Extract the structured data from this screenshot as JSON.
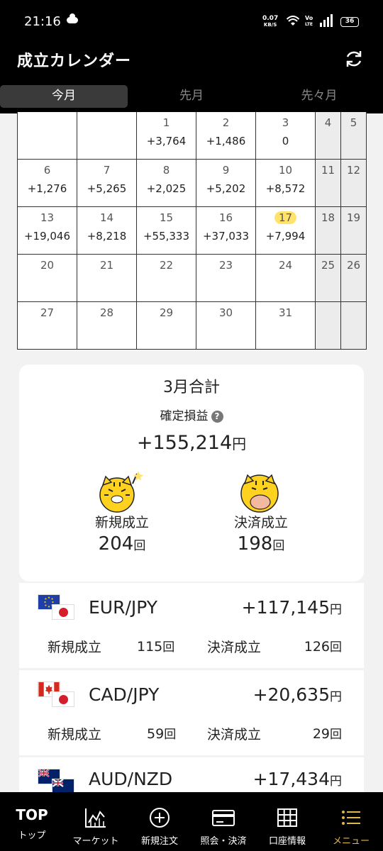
{
  "status_bar": {
    "time": "21:16",
    "net_speed_value": "0.07",
    "net_speed_unit": "KB/S",
    "volte_top": "Vo",
    "volte_bottom": "LTE",
    "battery": "36"
  },
  "header": {
    "title": "成立カレンダー",
    "refresh_icon": "refresh-icon"
  },
  "tabs": [
    {
      "label": "今月",
      "active": true
    },
    {
      "label": "先月",
      "active": false
    },
    {
      "label": "先々月",
      "active": false
    }
  ],
  "calendar": {
    "today": "17",
    "weeks": [
      [
        {
          "day": "",
          "value": ""
        },
        {
          "day": "",
          "value": ""
        },
        {
          "day": "1",
          "value": "+3,764"
        },
        {
          "day": "2",
          "value": "+1,486"
        },
        {
          "day": "3",
          "value": "0"
        },
        {
          "day": "4",
          "value": ""
        },
        {
          "day": "5",
          "value": ""
        }
      ],
      [
        {
          "day": "6",
          "value": "+1,276"
        },
        {
          "day": "7",
          "value": "+5,265"
        },
        {
          "day": "8",
          "value": "+2,025"
        },
        {
          "day": "9",
          "value": "+5,202"
        },
        {
          "day": "10",
          "value": "+8,572"
        },
        {
          "day": "11",
          "value": ""
        },
        {
          "day": "12",
          "value": ""
        }
      ],
      [
        {
          "day": "13",
          "value": "+19,046"
        },
        {
          "day": "14",
          "value": "+8,218"
        },
        {
          "day": "15",
          "value": "+55,333"
        },
        {
          "day": "16",
          "value": "+37,033"
        },
        {
          "day": "17",
          "value": "+7,994"
        },
        {
          "day": "18",
          "value": ""
        },
        {
          "day": "19",
          "value": ""
        }
      ],
      [
        {
          "day": "20",
          "value": ""
        },
        {
          "day": "21",
          "value": ""
        },
        {
          "day": "22",
          "value": ""
        },
        {
          "day": "23",
          "value": ""
        },
        {
          "day": "24",
          "value": ""
        },
        {
          "day": "25",
          "value": ""
        },
        {
          "day": "26",
          "value": ""
        }
      ],
      [
        {
          "day": "27",
          "value": ""
        },
        {
          "day": "28",
          "value": ""
        },
        {
          "day": "29",
          "value": ""
        },
        {
          "day": "30",
          "value": ""
        },
        {
          "day": "31",
          "value": ""
        },
        {
          "day": "",
          "value": ""
        },
        {
          "day": "",
          "value": ""
        }
      ]
    ]
  },
  "summary": {
    "title": "3月合計",
    "label": "確定損益",
    "help_glyph": "?",
    "amount": "+155,214",
    "amount_unit": "円",
    "new_label": "新規成立",
    "new_count": "204",
    "settle_label": "決済成立",
    "settle_count": "198",
    "count_unit": "回"
  },
  "pairs": [
    {
      "name": "EUR/JPY",
      "amount": "+117,145",
      "new_label": "新規成立",
      "new_count": "115",
      "settle_label": "決済成立",
      "settle_count": "126",
      "flag": "eu"
    },
    {
      "name": "CAD/JPY",
      "amount": "+20,635",
      "new_label": "新規成立",
      "new_count": "59",
      "settle_label": "決済成立",
      "settle_count": "29",
      "flag": "ca"
    },
    {
      "name": "AUD/NZD",
      "amount": "+17,434",
      "new_label": "",
      "new_count": "",
      "settle_label": "",
      "settle_count": "",
      "flag": "au"
    }
  ],
  "pair_units": {
    "amount_unit": "円",
    "count_unit": "回"
  },
  "bottom_nav": [
    {
      "label": "トップ",
      "icon": "top-text-icon",
      "icon_text": "TOP"
    },
    {
      "label": "マーケット",
      "icon": "chart-icon"
    },
    {
      "label": "新規注文",
      "icon": "plus-circle-icon"
    },
    {
      "label": "照会・決済",
      "icon": "card-icon"
    },
    {
      "label": "口座情報",
      "icon": "grid-icon"
    },
    {
      "label": "メニュー",
      "icon": "menu-icon",
      "active": true
    }
  ],
  "colors": {
    "header_bg": "#000000",
    "today_highlight": "#ffe36b",
    "weekend_bg": "#ececec",
    "active_nav": "#e0b84a"
  }
}
